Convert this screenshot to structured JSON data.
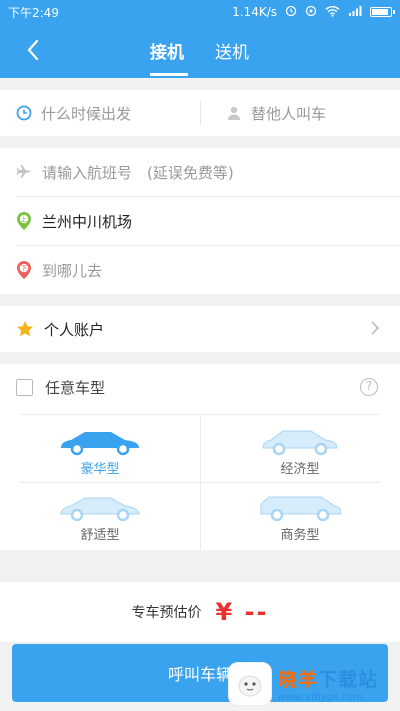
{
  "status_bar": {
    "time": "下午2:49",
    "network_speed": "1.14K/s"
  },
  "header": {
    "tabs": [
      {
        "label": "接机",
        "active": true
      },
      {
        "label": "送机",
        "active": false
      }
    ],
    "accent_color": "#3aa3ef"
  },
  "trip": {
    "time_placeholder": "什么时候出发",
    "call_for_other": "替他人叫车",
    "flight_placeholder": "请输入航班号　(延误免费等)",
    "pickup_location": "兰州中川机场",
    "pickup_badge": "上",
    "destination_placeholder": "到哪儿去",
    "destination_badge": "下"
  },
  "account": {
    "label": "个人账户"
  },
  "car_types": {
    "any_label": "任意车型",
    "help_glyph": "?",
    "items": [
      {
        "label": "豪华型",
        "selected": true
      },
      {
        "label": "经济型",
        "selected": false
      },
      {
        "label": "舒适型",
        "selected": false
      },
      {
        "label": "商务型",
        "selected": false
      }
    ]
  },
  "estimate": {
    "label": "专车预估价",
    "price": "¥ --"
  },
  "call_button": {
    "label": "呼叫车辆"
  },
  "watermark": {
    "title_a": "晓羊",
    "title_b": "下载站",
    "url": "www.xfhygs.com"
  }
}
